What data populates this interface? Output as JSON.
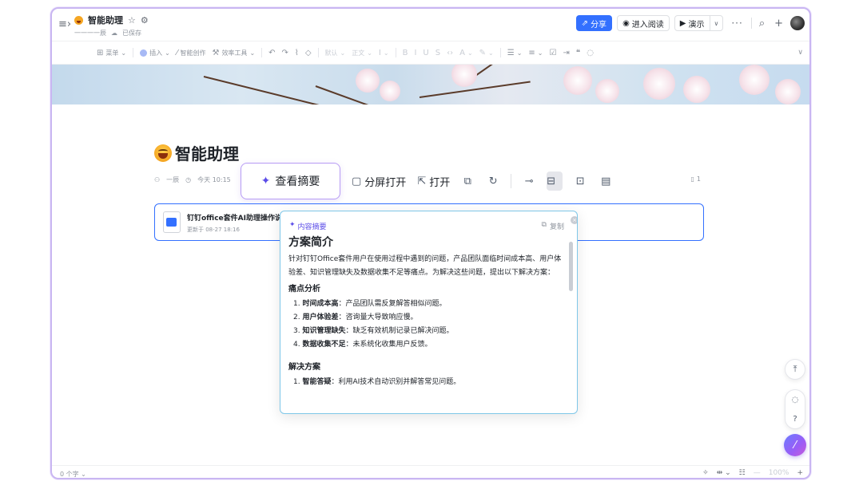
{
  "titlebar": {
    "doc_title": "智能助理",
    "owner": "一一一一辰",
    "save_status": "已保存",
    "share_label": "分享",
    "read_label": "进入阅读",
    "present_label": "演示"
  },
  "toolbar": {
    "menu": "菜单",
    "insert": "插入",
    "ai_create": "智能创作",
    "efficiency": "效率工具",
    "font_style": "默认",
    "body_text": "正文"
  },
  "doc": {
    "heading": "智能助理",
    "author": "一辰",
    "time": "今天 10:15",
    "page_count": "1"
  },
  "block_toolbar": {
    "summary": "查看摘要",
    "split_open": "分屏打开",
    "open": "打开"
  },
  "file_card": {
    "name": "钉钉office套件AI助理操作说明",
    "updated": "更新于 08-27 18:16"
  },
  "summary": {
    "label": "内容摘要",
    "copy": "复制",
    "title": "方案简介",
    "intro": "针对钉钉Office套件用户在使用过程中遇到的问题，产品团队面临时间成本高、用户体验差、知识管理缺失及数据收集不足等痛点。为解决这些问题，提出以下解决方案：",
    "pain_heading": "痛点分析",
    "pain_points": [
      {
        "num": "1.",
        "key": "时间成本高",
        "desc": "：产品团队需反复解答相似问题。"
      },
      {
        "num": "2.",
        "key": "用户体验差",
        "desc": "：咨询量大导致响应慢。"
      },
      {
        "num": "3.",
        "key": "知识管理缺失",
        "desc": "：缺乏有效机制记录已解决问题。"
      },
      {
        "num": "4.",
        "key": "数据收集不足",
        "desc": "：未系统化收集用户反馈。"
      }
    ],
    "solution_heading": "解决方案",
    "solutions": [
      {
        "num": "1.",
        "key": "智能答疑",
        "desc": "：利用AI技术自动识别并解答常见问题。"
      }
    ]
  },
  "statusbar": {
    "word_count": "0 个字",
    "zoom": "100%"
  },
  "icons": {
    "sidebar": "sidebar-toggle-icon",
    "star": "star-icon",
    "settings": "settings-icon",
    "cloud": "cloud-saved-icon",
    "search": "search-icon",
    "plus": "plus-icon",
    "more": "more-icon"
  },
  "colors": {
    "accent": "#3370ff",
    "ai_purple": "#5b4ce8",
    "popover_border": "#7fc7e8"
  }
}
